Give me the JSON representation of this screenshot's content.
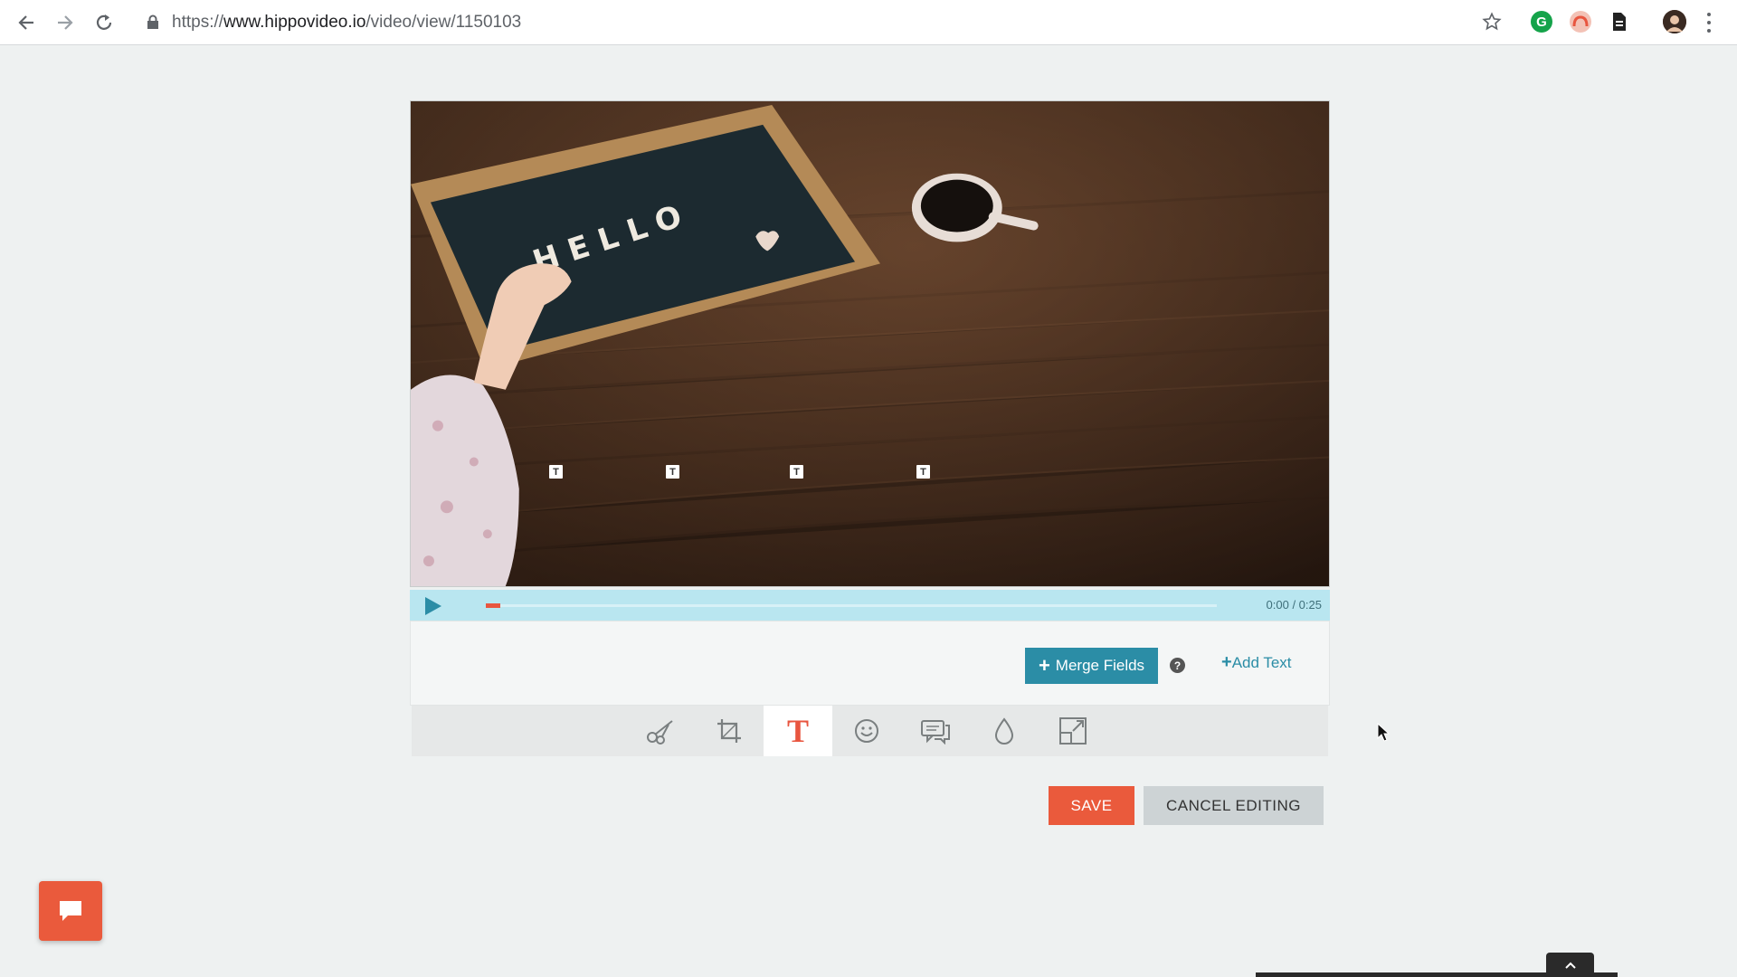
{
  "browser": {
    "url_prefix": "https://",
    "url_host": "www.hippovideo.io",
    "url_path": "/video/view/1150103"
  },
  "video": {
    "board_text": "HELLO",
    "text_markers": [
      "T",
      "T",
      "T",
      "T"
    ],
    "progress": 0.02
  },
  "player": {
    "time": "0:00 / 0:25"
  },
  "editor": {
    "merge_fields_plus": "+",
    "merge_fields_label": "Merge Fields",
    "help_label": "?",
    "add_text_plus": "+",
    "add_text_label": "Add Text",
    "tools": [
      {
        "name": "trim",
        "icon": "scissors-icon"
      },
      {
        "name": "crop",
        "icon": "crop-icon"
      },
      {
        "name": "text",
        "icon": "text-icon",
        "label": "T",
        "active": true
      },
      {
        "name": "emoji",
        "icon": "smiley-icon"
      },
      {
        "name": "callout",
        "icon": "speech-bubbles-icon"
      },
      {
        "name": "blur",
        "icon": "droplet-icon"
      },
      {
        "name": "resize",
        "icon": "resize-icon"
      }
    ]
  },
  "actions": {
    "save_label": "SAVE",
    "cancel_label": "CANCEL EDITING"
  },
  "colors": {
    "accent": "#2b8da6",
    "save": "#ea5a3c",
    "player_bar": "#b9e6f0"
  }
}
